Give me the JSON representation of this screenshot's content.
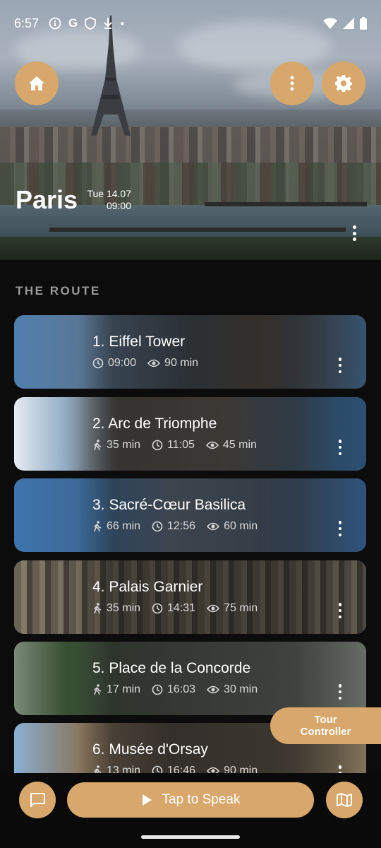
{
  "status_bar": {
    "time": "6:57"
  },
  "header": {
    "city": "Paris",
    "date": "Tue 14.07",
    "time": "09:00"
  },
  "route": {
    "section_title": "THE ROUTE",
    "stops": [
      {
        "title": "1. Eiffel Tower",
        "walk": "",
        "start": "09:00",
        "duration": "90 min"
      },
      {
        "title": "2. Arc de Triomphe",
        "walk": "35 min",
        "start": "11:05",
        "duration": "45 min"
      },
      {
        "title": "3. Sacré-Cœur Basilica",
        "walk": "66 min",
        "start": "12:56",
        "duration": "60 min"
      },
      {
        "title": "4. Palais Garnier",
        "walk": "35 min",
        "start": "14:31",
        "duration": "75 min"
      },
      {
        "title": "5. Place de la Concorde",
        "walk": "17 min",
        "start": "16:03",
        "duration": "30 min"
      },
      {
        "title": "6. Musée d'Orsay",
        "walk": "13 min",
        "start": "16:46",
        "duration": "90 min"
      }
    ]
  },
  "tour_controller": {
    "line1": "Tour",
    "line2": "Controller"
  },
  "bottom_bar": {
    "speak_label": "Tap to Speak"
  },
  "colors": {
    "accent": "#d8a76b",
    "background": "#0c0c0c"
  }
}
